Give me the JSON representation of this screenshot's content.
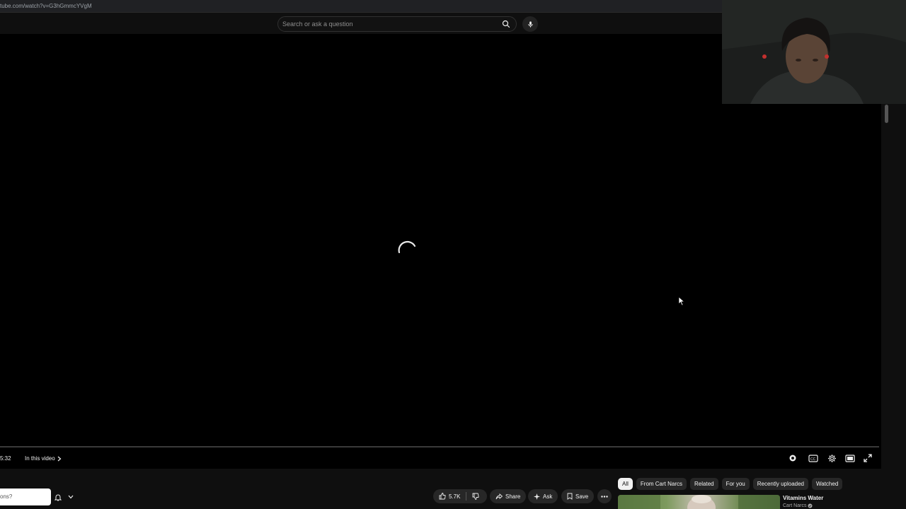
{
  "browser": {
    "url": "tube.com/watch?v=G3hGmmcYVgM"
  },
  "masthead": {
    "search_placeholder": "Search or ask a question",
    "search_icon": "search-icon",
    "mic_icon": "microphone-icon"
  },
  "player": {
    "state": "loading",
    "time": "5:32",
    "chapter_label": "In this video",
    "controls": [
      "autoplay-toggle-icon",
      "captions-icon",
      "settings-gear-icon",
      "theater-mode-icon",
      "fullscreen-icon"
    ]
  },
  "below": {
    "ask_chip_text": "ons?",
    "like_count": "5.7K",
    "share_label": "Share",
    "ask_label": "Ask",
    "save_label": "Save"
  },
  "related": {
    "chips": [
      "All",
      "From Cart Narcs",
      "Related",
      "For you",
      "Recently uploaded",
      "Watched"
    ],
    "active_chip": "All",
    "video": {
      "title": "Vitamins Water",
      "channel": "Cart Narcs"
    }
  },
  "colors": {
    "background": "#0f0f0f",
    "pill": "#272727",
    "text": "#f1f1f1",
    "muted": "#aaaaaa"
  }
}
